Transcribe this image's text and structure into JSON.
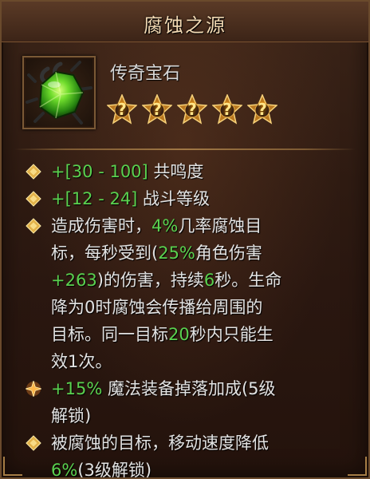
{
  "title": "腐蚀之源",
  "item": {
    "type_label": "传奇宝石",
    "icon": "green-crystal-gem-icon",
    "sockets": [
      "?",
      "?",
      "?",
      "?",
      "?"
    ]
  },
  "affixes": [
    {
      "bullet": "diamond-bullet-icon",
      "lines": [
        [
          [
            "+",
            "g"
          ],
          [
            "[30 - 100]",
            "g"
          ],
          [
            " 共鸣度",
            "w"
          ]
        ]
      ]
    },
    {
      "bullet": "diamond-bullet-icon",
      "lines": [
        [
          [
            "+",
            "g"
          ],
          [
            "[12 - 24]",
            "g"
          ],
          [
            " 战斗等级",
            "w"
          ]
        ]
      ]
    },
    {
      "bullet": "diamond-bullet-icon",
      "lines": [
        [
          [
            "造成伤害时，",
            "w"
          ],
          [
            "4%",
            "g"
          ],
          [
            "几率腐蚀目",
            "w"
          ]
        ],
        [
          [
            "标，每秒受到(",
            "w"
          ],
          [
            "25%",
            "g"
          ],
          [
            "角色伤害",
            "w"
          ]
        ],
        [
          [
            "+263",
            "g"
          ],
          [
            ")的伤害，持续",
            "w"
          ],
          [
            "6",
            "g"
          ],
          [
            "秒。生命",
            "w"
          ]
        ],
        [
          [
            "降为0时腐蚀会传播给周围的",
            "w"
          ]
        ],
        [
          [
            "目标。同一目标",
            "w"
          ],
          [
            "20",
            "g"
          ],
          [
            "秒内只能生",
            "w"
          ]
        ],
        [
          [
            "效1次。",
            "w"
          ]
        ]
      ]
    },
    {
      "bullet": "star-bullet-icon",
      "lines": [
        [
          [
            "+15%",
            "g"
          ],
          [
            " 魔法装备掉落加成(5级",
            "w"
          ]
        ],
        [
          [
            "解锁)",
            "w"
          ]
        ]
      ]
    },
    {
      "bullet": "diamond-bullet-icon",
      "lines": [
        [
          [
            "被腐蚀的目标，移动速度降低",
            "w"
          ]
        ],
        [
          [
            "6%",
            "g"
          ],
          [
            "(3级解锁)",
            "w"
          ]
        ]
      ]
    }
  ],
  "colors": {
    "value_green": "#5ad14f",
    "text": "#e3e3e3",
    "title": "#f2d9b3",
    "gold": "#e2b24a"
  }
}
